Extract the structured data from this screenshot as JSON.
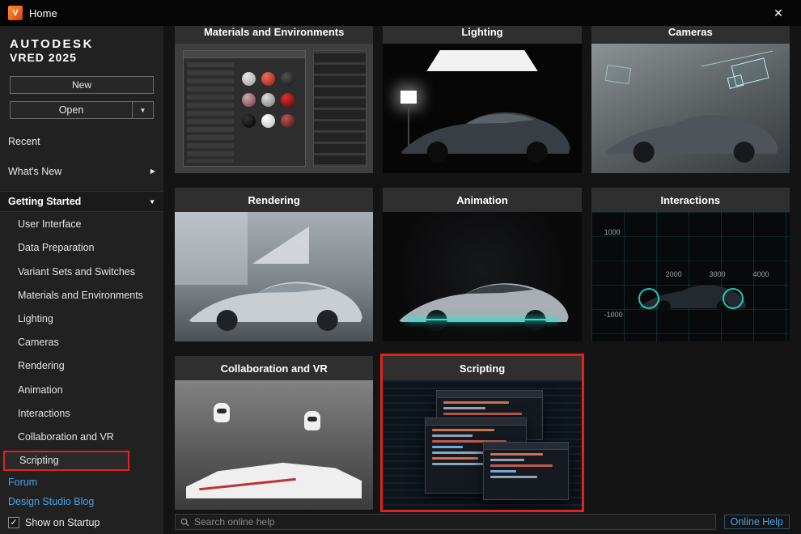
{
  "colors": {
    "accent_red": "#e0241b",
    "link_blue": "#4ba3e3",
    "brand_orange": "#f26722"
  },
  "icons": {
    "close": "✕",
    "caret_down": "▼",
    "caret_right": "▶",
    "check": "✓",
    "logo_letter": "V"
  },
  "window": {
    "title": "Home"
  },
  "sidebar": {
    "brand_line1": "AUTODESK",
    "brand_line2": "VRED 2025",
    "new_button": "New",
    "open_button": "Open",
    "recent": "Recent",
    "whats_new": "What's New",
    "getting_started": "Getting Started",
    "sub_items": [
      {
        "label": "User Interface"
      },
      {
        "label": "Data Preparation"
      },
      {
        "label": "Variant Sets and Switches"
      },
      {
        "label": "Materials and Environments"
      },
      {
        "label": "Lighting"
      },
      {
        "label": "Cameras"
      },
      {
        "label": "Rendering"
      },
      {
        "label": "Animation"
      },
      {
        "label": "Interactions"
      },
      {
        "label": "Collaboration and VR"
      },
      {
        "label": "Scripting"
      }
    ],
    "links": [
      {
        "label": "Forum"
      },
      {
        "label": "Design Studio Blog"
      }
    ],
    "show_on_startup": "Show on Startup"
  },
  "main": {
    "cards": [
      {
        "title": "Materials and Environments"
      },
      {
        "title": "Lighting"
      },
      {
        "title": "Cameras"
      },
      {
        "title": "Rendering"
      },
      {
        "title": "Animation"
      },
      {
        "title": "Interactions",
        "labels": {
          "l1": "1000",
          "l2": "2000",
          "l3": "3000",
          "l4": "4000",
          "l5": "-1000"
        }
      },
      {
        "title": "Collaboration and VR"
      },
      {
        "title": "Scripting"
      }
    ]
  },
  "footer": {
    "search_placeholder": "Search online help",
    "online_help": "Online Help"
  }
}
